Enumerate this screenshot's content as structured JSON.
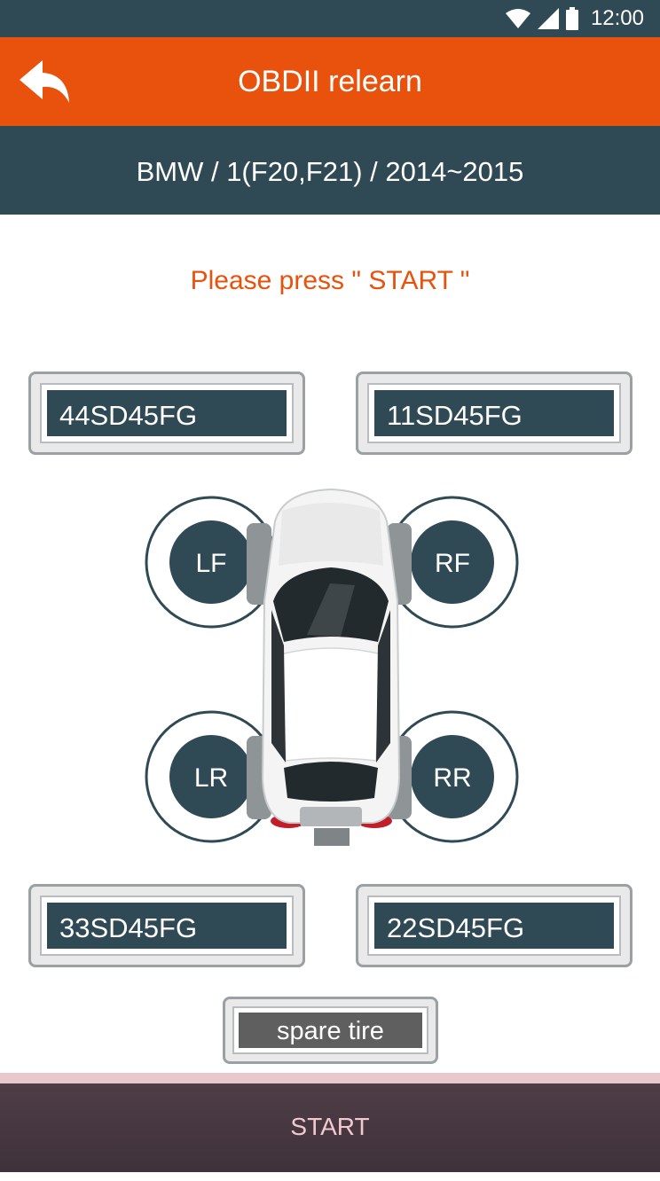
{
  "status_bar": {
    "time": "12:00",
    "icons": [
      "wifi-icon",
      "signal-icon",
      "battery-icon"
    ]
  },
  "toolbar": {
    "title": "OBDII relearn",
    "back_icon": "back-arrow-icon"
  },
  "vehicle": {
    "label": "BMW / 1(F20,F21) / 2014~2015"
  },
  "prompt": "Please press \" START \"",
  "sensors": {
    "lf": "44SD45FG",
    "rf": "11SD45FG",
    "lr": "33SD45FG",
    "rr": "22SD45FG"
  },
  "wheels": {
    "lf": "LF",
    "rf": "RF",
    "lr": "LR",
    "rr": "RR"
  },
  "spare_label": "spare tire",
  "start_label": "START",
  "colors": {
    "accent": "#e8520c",
    "dark": "#2f4955",
    "start_bg": "#4e3d46",
    "start_text": "#f1c9cf"
  }
}
